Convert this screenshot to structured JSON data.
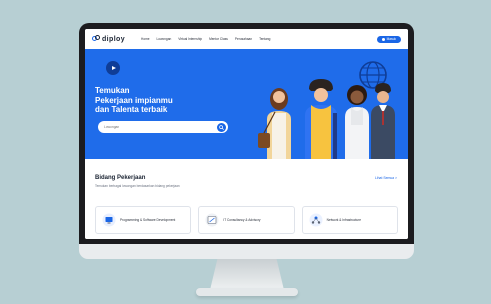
{
  "nav": {
    "logo": "diploy",
    "items": [
      {
        "label": "Home"
      },
      {
        "label": "Lowongan"
      },
      {
        "label": "Virtual Internship"
      },
      {
        "label": "Mentor Class"
      },
      {
        "label": "Perusahaan"
      },
      {
        "label": "Tentang"
      }
    ],
    "login_label": "Masuk"
  },
  "hero": {
    "title_line1": "Temukan",
    "title_line2": "Pekerjaan impianmu",
    "title_line3": "dan Talenta terbaik",
    "search_placeholder": "Lowongan"
  },
  "section": {
    "title": "Bidang Pekerjaan",
    "subtitle": "Temukan berbagai lowongan berdasarkan bidang pekerjaan",
    "see_all": "Lihat Semua >"
  },
  "categories": [
    {
      "label": "Programming & Software Development",
      "icon": "programming-icon"
    },
    {
      "label": "IT Consultancy & Advisory",
      "icon": "consultancy-icon"
    },
    {
      "label": "Network & Infrastructure",
      "icon": "network-icon"
    }
  ],
  "colors": {
    "primary": "#1a66e6",
    "hero_bg": "#1f6cea",
    "backdrop": "#b7cfd3",
    "bezel": "#1c1c1f"
  }
}
